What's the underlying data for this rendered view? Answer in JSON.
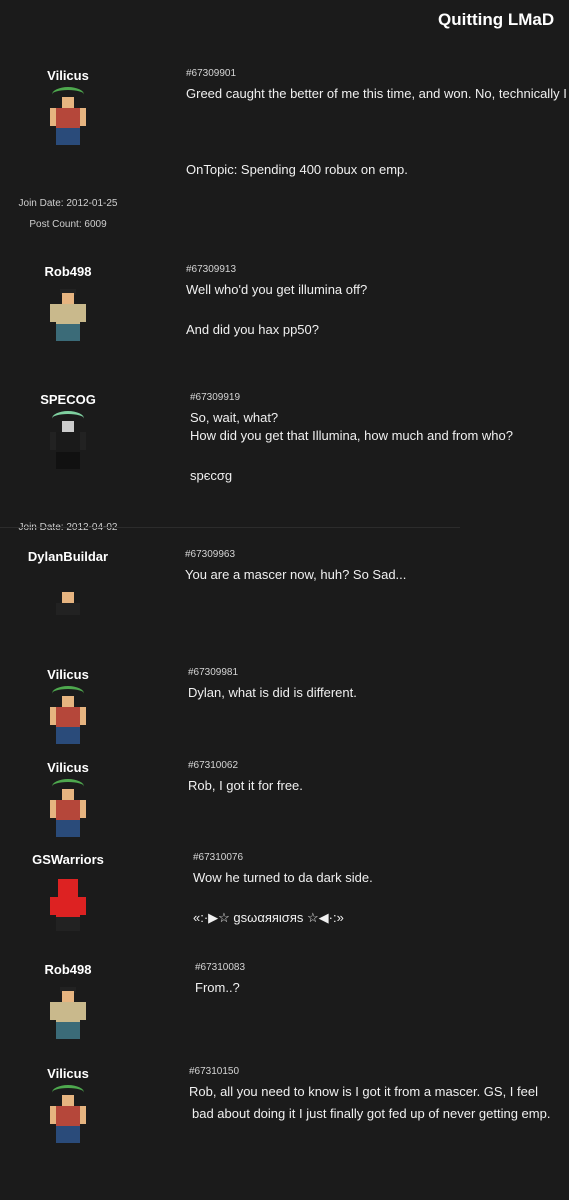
{
  "thread": {
    "title": "Quitting LMaD"
  },
  "posts": [
    {
      "username": "Vilicus",
      "join_date": "Join Date: 2012-01-25",
      "post_count": "Post Count: 6009",
      "post_id": "#67309901",
      "lines": [
        "Greed caught the better of me this time, and won. No, technically I d",
        "OnTopic: Spending 400 robux on emp."
      ]
    },
    {
      "username": "Rob498",
      "post_id": "#67309913",
      "lines": [
        "Well who'd you get illumina off?",
        "And did you hax pp50?"
      ]
    },
    {
      "username": "SPECOG",
      "join_date": "Join Date: 2012-04-02",
      "post_id": "#67309919",
      "lines": [
        "So, wait, what?",
        "How did you get that Illumina, how much and from who?",
        "spєcσg"
      ]
    },
    {
      "username": "DylanBuildar",
      "post_id": "#67309963",
      "lines": [
        "You are a mascer now, huh? So Sad..."
      ]
    },
    {
      "username": "Vilicus",
      "post_id": "#67309981",
      "lines": [
        "Dylan, what is did is different."
      ]
    },
    {
      "username": "Vilicus",
      "post_id": "#67310062",
      "lines": [
        "Rob, I got it for free."
      ]
    },
    {
      "username": "GSWarriors",
      "post_id": "#67310076",
      "lines": [
        "Wow he turned to da dark side.",
        "«:·▶☆ gsωαяяισяs ☆◀·:»"
      ]
    },
    {
      "username": "Rob498",
      "post_id": "#67310083",
      "lines": [
        "From..?"
      ]
    },
    {
      "username": "Vilicus",
      "post_id": "#67310150",
      "lines": [
        "Rob, all you need to know is I got it from a mascer. GS, I feel",
        "bad about doing it I just finally got fed up of never getting emp."
      ]
    }
  ]
}
